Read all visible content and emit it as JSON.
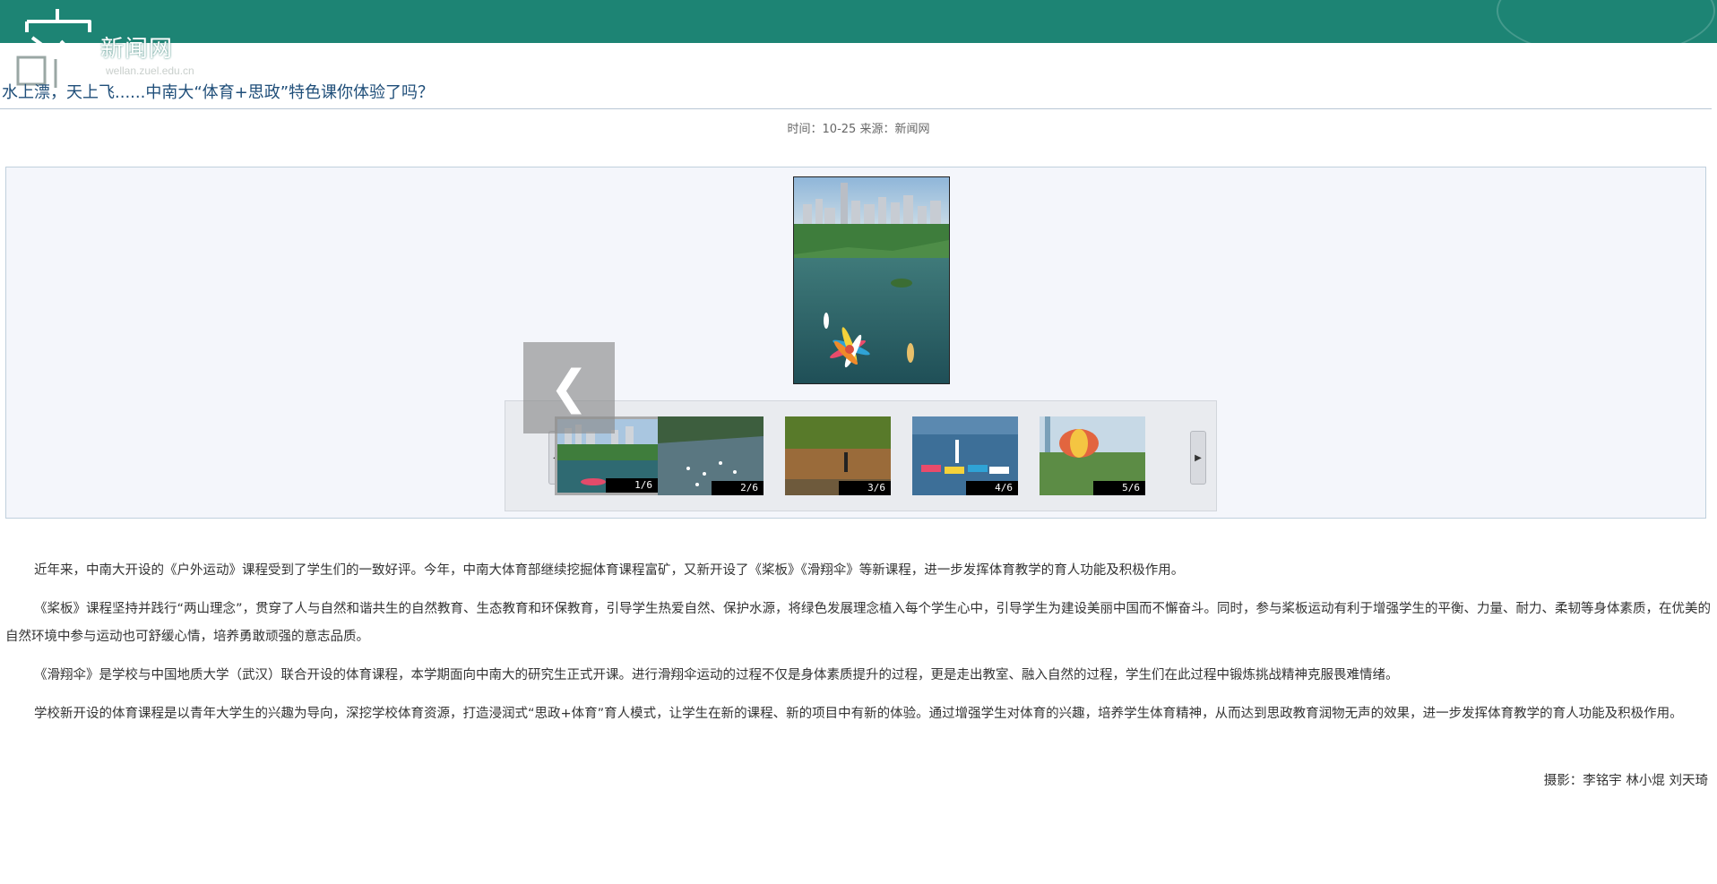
{
  "header": {
    "logo_text": "新闻网",
    "logo_domain": "wellan.zuel.edu.cn",
    "bar_color": "#1d8474"
  },
  "article": {
    "title": "水上漂，天上飞......中南大“体育+思政”特色课你体验了吗？",
    "meta": "时间：10-25  来源：新闻网"
  },
  "gallery": {
    "prev_icon": "chevron-left-icon",
    "thumbnails": [
      {
        "label": "1/6",
        "active": true
      },
      {
        "label": "2/6",
        "active": false
      },
      {
        "label": "3/6",
        "active": false
      },
      {
        "label": "4/6",
        "active": false
      },
      {
        "label": "5/6",
        "active": false
      }
    ]
  },
  "body": {
    "paragraphs": [
      "近年来，中南大开设的《户外运动》课程受到了学生们的一致好评。今年，中南大体育部继续挖掘体育课程富矿，又新开设了《桨板》《滑翔伞》等新课程，进一步发挥体育教学的育人功能及积极作用。",
      "《桨板》课程坚持并践行“两山理念”，贯穿了人与自然和谐共生的自然教育、生态教育和环保教育，引导学生热爱自然、保护水源，将绿色发展理念植入每个学生心中，引导学生为建设美丽中国而不懈奋斗。同时，参与桨板运动有利于增强学生的平衡、力量、耐力、柔韧等身体素质，在优美的自然环境中参与运动也可舒缓心情，培养勇敢顽强的意志品质。",
      "《滑翔伞》是学校与中国地质大学（武汉）联合开设的体育课程，本学期面向中南大的研究生正式开课。进行滑翔伞运动的过程不仅是身体素质提升的过程，更是走出教室、融入自然的过程，学生们在此过程中锻炼挑战精神克服畏难情绪。",
      "学校新开设的体育课程是以青年大学生的兴趣为导向，深挖学校体育资源，打造浸润式“思政+体育”育人模式，让学生在新的课程、新的项目中有新的体验。通过增强学生对体育的兴趣，培养学生体育精神，从而达到思政教育润物无声的效果，进一步发挥体育教学的育人功能及积极作用。"
    ],
    "credit": "摄影：李铭宇 林小焜 刘天琦"
  }
}
